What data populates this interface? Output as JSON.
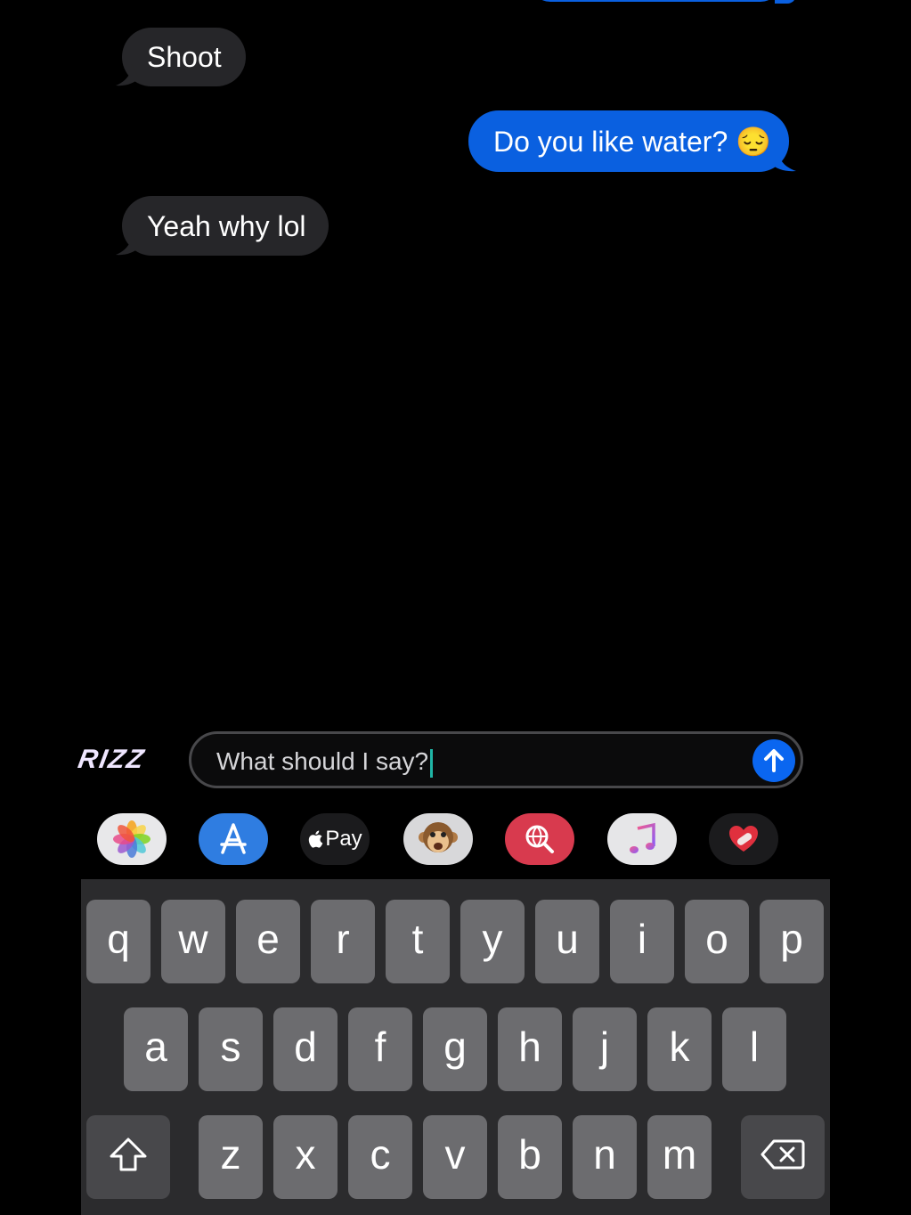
{
  "messages": [
    {
      "side": "in",
      "text": "Shoot"
    },
    {
      "side": "out",
      "text": "Do you like water? 😔"
    },
    {
      "side": "in",
      "text": "Yeah why lol"
    }
  ],
  "composer": {
    "logo": "RIZZ",
    "text": "What should I say?"
  },
  "app_strip": [
    {
      "name": "photos-icon"
    },
    {
      "name": "app-store-icon"
    },
    {
      "name": "apple-pay-icon",
      "label": "Pay"
    },
    {
      "name": "animoji-monkey-icon"
    },
    {
      "name": "web-search-icon"
    },
    {
      "name": "music-icon"
    },
    {
      "name": "digital-touch-icon"
    }
  ],
  "keyboard": {
    "row1": [
      "q",
      "w",
      "e",
      "r",
      "t",
      "y",
      "u",
      "i",
      "o",
      "p"
    ],
    "row2": [
      "a",
      "s",
      "d",
      "f",
      "g",
      "h",
      "j",
      "k",
      "l"
    ],
    "row3": [
      "z",
      "x",
      "c",
      "v",
      "b",
      "n",
      "m"
    ]
  },
  "colors": {
    "outgoing_bubble": "#0a60e0",
    "incoming_bubble": "#262629",
    "keyboard_bg": "#2b2b2d",
    "key": "#6c6c6f"
  }
}
